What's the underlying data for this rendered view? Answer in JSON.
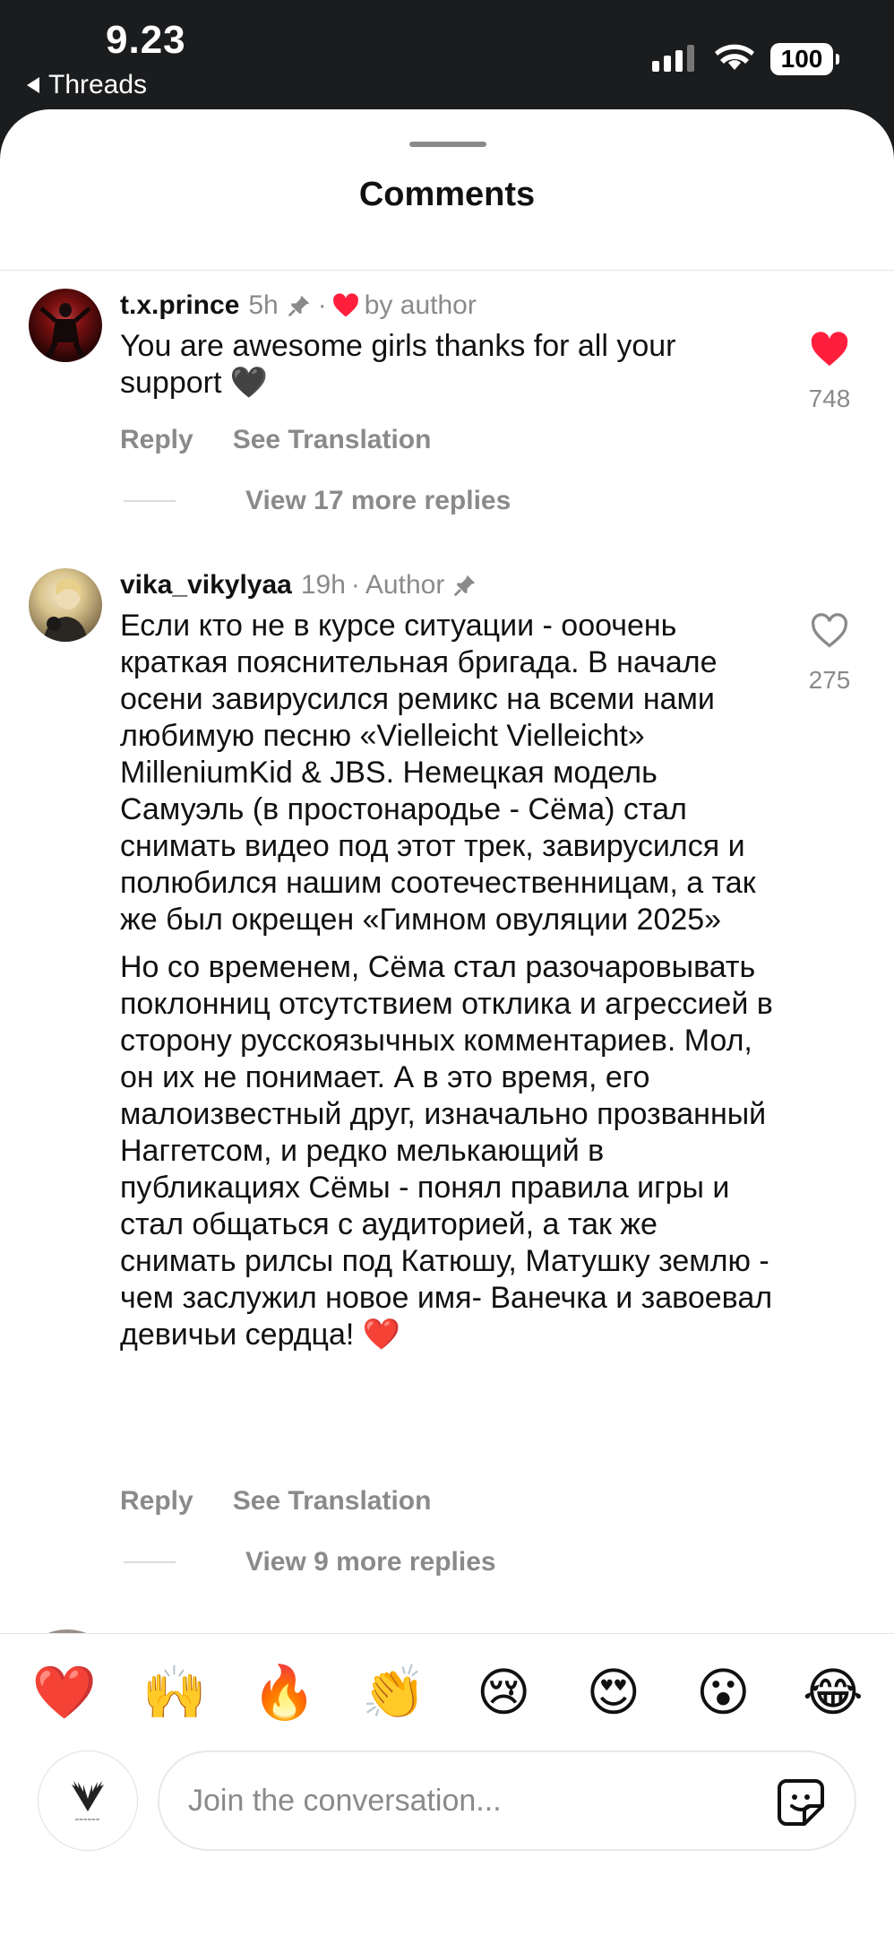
{
  "status_bar": {
    "time": "9.23",
    "back_app": "Threads",
    "battery": "100"
  },
  "sheet": {
    "title": "Comments"
  },
  "comments": [
    {
      "username": "t.x.prince",
      "age": "5h",
      "badge": "by author",
      "icons": [
        "pin-icon",
        "heart-icon"
      ],
      "paragraphs": [
        "You are awesome girls thanks for all your support 🖤"
      ],
      "likes": "748",
      "liked": true,
      "reply_label": "Reply",
      "translate_label": "See Translation",
      "view_replies": "View 17 more replies"
    },
    {
      "username": "vika_vikylyaa",
      "age": "19h",
      "badge": "Author",
      "icons": [
        "pin-icon"
      ],
      "paragraphs": [
        "Если кто не в курсе ситуации - ооочень краткая пояснительная бригада. В начале осени завирусился ремикс на всеми нами любимую песню «Vielleicht Vielleicht» MilleniumKid & JBS. Немецкая модель Самуэль (в простонародье - Сёма) стал снимать видео под этот трек, завирусился и полюбился нашим соотечественницам, а так же был окрещен «Гимном овуляции 2025»",
        "Но со временем, Сёма стал разочаровывать поклонниц отсутствием отклика и агрессией в сторону русскоязычных комментариев. Мол, он их не понимает. А в это время, его малоизвестный друг, изначально прозванный Наггетсом, и редко мелькающий в публикациях Сёмы - понял правила игры и стал общаться с аудиторией, а так же снимать рилсы под Катюшу, Матушку землю - чем заслужил новое имя- Ванечка и завоевал девичьи сердца! ❤️"
      ],
      "likes": "275",
      "liked": false,
      "reply_label": "Reply",
      "translate_label": "See Translation",
      "view_replies": "View 9 more replies"
    }
  ],
  "reactions": [
    "❤️",
    "🙌",
    "🔥",
    "👏",
    "😢",
    "😍",
    "😮",
    "😂"
  ],
  "composer": {
    "placeholder": "Join the conversation..."
  },
  "colors": {
    "accent_red": "#ff1f3d",
    "muted": "#8a8a8a",
    "text": "#111111"
  }
}
